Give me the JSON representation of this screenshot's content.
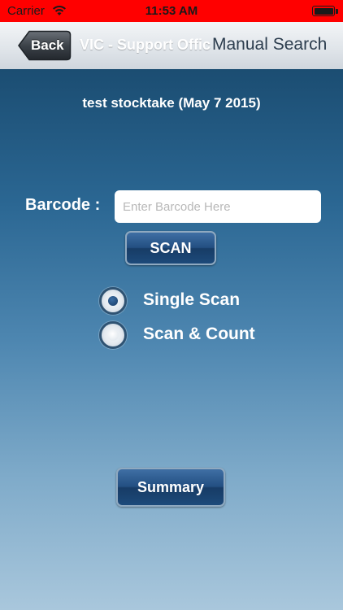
{
  "status_bar": {
    "carrier": "Carrier",
    "time": "11:53 AM",
    "background_color": "#ff0000",
    "wifi_icon": "wifi-icon",
    "battery_icon": "battery-icon"
  },
  "nav_bar": {
    "back_label": "Back",
    "subtitle": "VIC - Support Offic",
    "title": "Manual Search"
  },
  "main": {
    "stocktake_title": "test stocktake (May  7 2015)",
    "barcode_label": "Barcode :",
    "barcode_placeholder": "Enter Barcode Here",
    "barcode_value": "",
    "scan_label": "SCAN",
    "scan_modes": [
      {
        "label": "Single Scan",
        "selected": true
      },
      {
        "label": "Scan & Count",
        "selected": false
      }
    ],
    "summary_label": "Summary"
  }
}
